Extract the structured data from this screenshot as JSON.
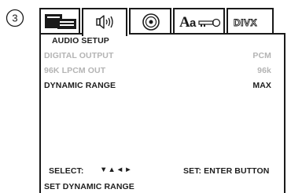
{
  "step_marker": "3",
  "tabs": [
    {
      "icon": "general-setup-icon",
      "active": false
    },
    {
      "icon": "speaker-audio-icon",
      "active": true
    },
    {
      "icon": "disc-icon",
      "active": false
    },
    {
      "icon": "language-key-icon",
      "label": "Aa",
      "active": false
    },
    {
      "icon": "divx-icon",
      "label": "DIVX",
      "active": false
    }
  ],
  "menu": {
    "title": "AUDIO SETUP",
    "rows": [
      {
        "label": "DIGITAL OUTPUT",
        "value": "PCM",
        "enabled": false
      },
      {
        "label": "96K LPCM OUT",
        "value": "96k",
        "enabled": false
      },
      {
        "label": "DYNAMIC RANGE",
        "value": "MAX",
        "enabled": true
      }
    ]
  },
  "footer": {
    "select_label": "SELECT:",
    "arrows": "▼▲◄►",
    "set_label": "SET: ENTER BUTTON",
    "help_text": "SET DYNAMIC RANGE"
  },
  "colors": {
    "text": "#1e1e1e",
    "disabled": "#b4b4b4",
    "border": "#1a1a1a"
  }
}
